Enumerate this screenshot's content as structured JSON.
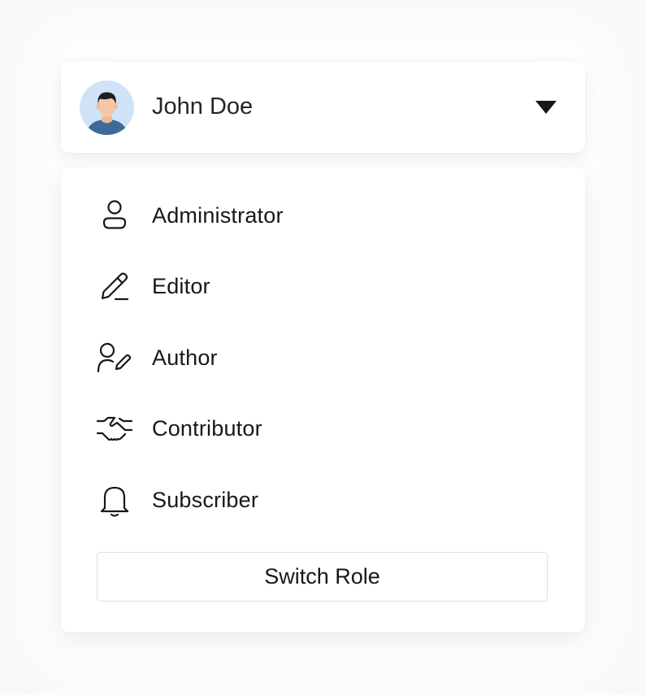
{
  "user": {
    "name": "John Doe",
    "avatar_icon": "user-avatar"
  },
  "roles": [
    {
      "label": "Administrator",
      "icon": "user-icon"
    },
    {
      "label": "Editor",
      "icon": "pencil-icon"
    },
    {
      "label": "Author",
      "icon": "user-pen-icon"
    },
    {
      "label": "Contributor",
      "icon": "handshake-icon"
    },
    {
      "label": "Subscriber",
      "icon": "bell-icon"
    }
  ],
  "actions": {
    "switch_role_label": "Switch Role"
  },
  "colors": {
    "text": "#15181d",
    "avatar_bg": "#cfe2f6",
    "button_border": "#d8e1ee"
  }
}
